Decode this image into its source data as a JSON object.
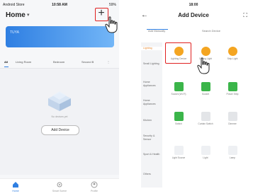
{
  "left": {
    "status": {
      "left": "Android Store",
      "time": "10:58 AM",
      "right": "59%"
    },
    "home_title": "Home",
    "banner": {
      "line1": "TUYA",
      "line2": ""
    },
    "tabs": [
      "All",
      "Living Room",
      "Bedroom",
      "Second B"
    ],
    "empty_text": "No devices yet",
    "add_device": "Add Device",
    "nav": [
      "Home",
      "Smart Scene",
      "Profile"
    ]
  },
  "right": {
    "status": {
      "left": "",
      "time": "18:00",
      "right": ""
    },
    "title": "Add Device",
    "segments": [
      "Add Manually",
      "Search Device"
    ],
    "categories": [
      "Lighting",
      "Small Lighting",
      "Home Appliances",
      "Home Appliances",
      "Kitchen",
      "Security & Sensor",
      "Sport & Health",
      "Others"
    ],
    "devices": [
      [
        "Lighting Device",
        "Ceiling Light",
        "Strip Light"
      ],
      [
        "Socket (Wi-Fi)",
        "Socket",
        "Power Strip"
      ],
      [
        "Switch",
        "Curtain Switch",
        "Dimmer"
      ],
      [
        "Light Source",
        "Light",
        "Lamp"
      ]
    ]
  },
  "colors": {
    "accent": "#2f7fe2",
    "highlight": "#e02020",
    "bulb": "#f4a521",
    "switch": "#3bb54a"
  }
}
